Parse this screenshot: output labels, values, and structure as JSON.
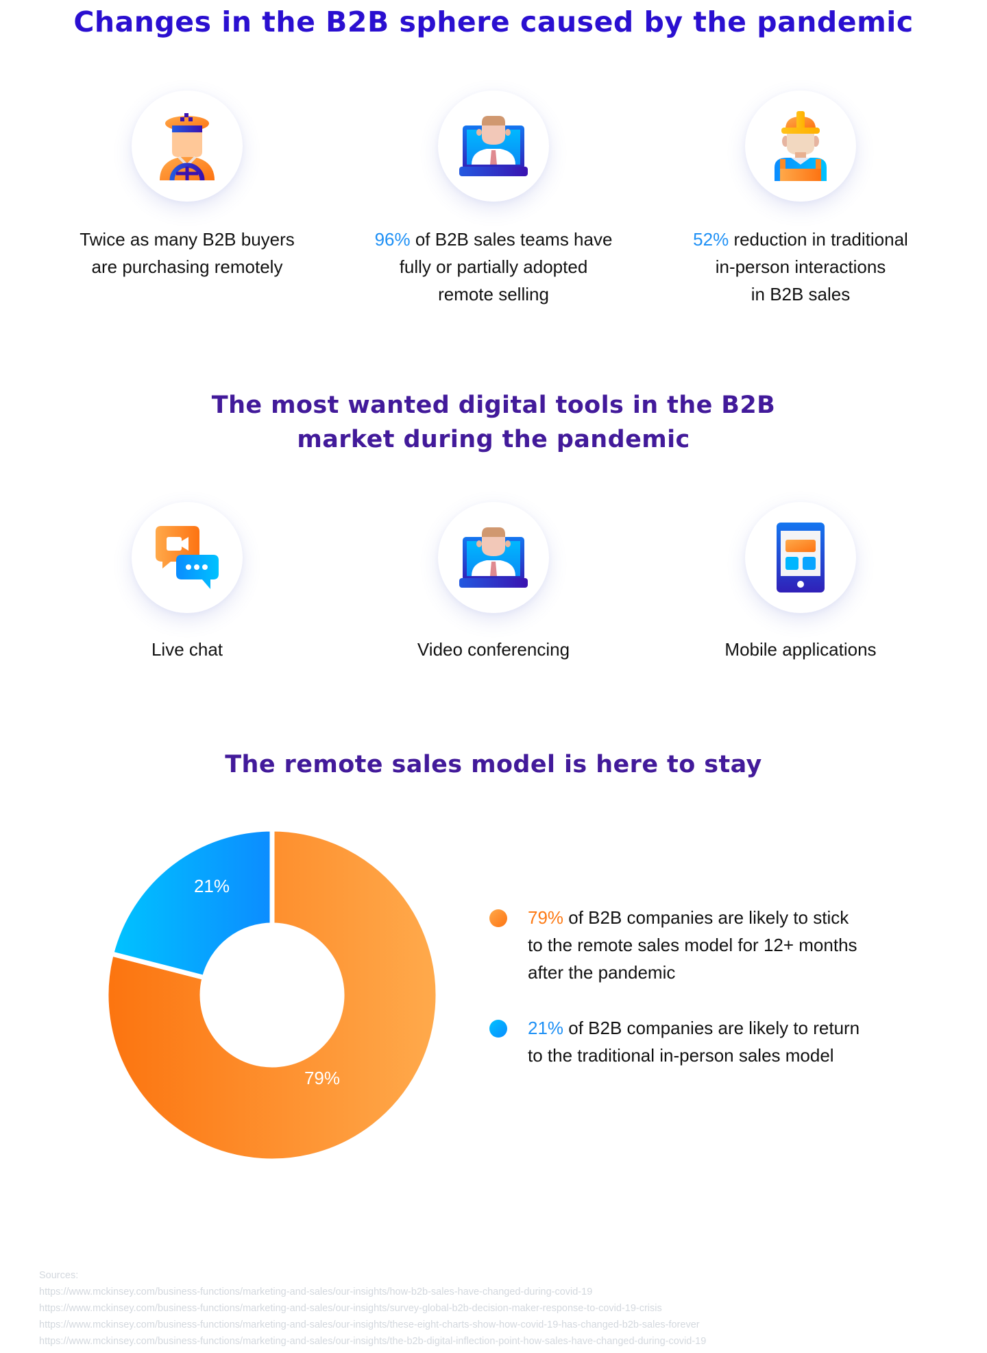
{
  "section1": {
    "title": "Changes in the B2B sphere caused by the pandemic",
    "stats": [
      {
        "icon": "taxi-driver-icon",
        "highlight": "",
        "lines": [
          "Twice as many B2B buyers",
          "are purchasing remotely"
        ]
      },
      {
        "icon": "laptop-person-icon",
        "highlight": "96%",
        "lines": [
          " of B2B sales teams have",
          "fully or partially adopted",
          "remote selling"
        ]
      },
      {
        "icon": "construction-worker-icon",
        "highlight": "52%",
        "lines": [
          " reduction in traditional",
          "in-person interactions",
          "in B2B sales"
        ]
      }
    ]
  },
  "section2": {
    "title_line1": "The most wanted digital tools in the B2B",
    "title_line2": "market during the pandemic",
    "tools": [
      {
        "icon": "live-chat-icon",
        "label": "Live chat"
      },
      {
        "icon": "video-conferencing-icon",
        "label": "Video conferencing"
      },
      {
        "icon": "mobile-app-icon",
        "label": "Mobile applications"
      }
    ]
  },
  "section3": {
    "title": "The remote sales model is here to stay",
    "legend": [
      {
        "highlight": "79%",
        "line1": " of B2B companies are likely to stick",
        "line2": "to the remote sales model for 12+ months",
        "line3": "after the pandemic"
      },
      {
        "highlight": "21%",
        "line1": " of B2B companies are likely to return",
        "line2": "to the traditional in-person sales model"
      }
    ]
  },
  "chart_data": {
    "type": "pie",
    "variant": "donut",
    "title": "The remote sales model is here to stay",
    "categories": [
      "Stick to the remote sales model for 12+ months",
      "Return to the traditional in-person sales model"
    ],
    "values": [
      79,
      21
    ],
    "labels": [
      "79%",
      "21%"
    ],
    "colors": [
      "#fd8a24",
      "#08a8ff"
    ],
    "legend_position": "right"
  },
  "colors": {
    "title": "#2a0fd0",
    "subtitle": "#421a9a",
    "highlight_blue": "#1e90f5",
    "highlight_orange": "#fd7a15",
    "sources_text": "#d3d8de"
  },
  "sources": {
    "heading": "Sources:",
    "links": [
      "https://www.mckinsey.com/business-functions/marketing-and-sales/our-insights/how-b2b-sales-have-changed-during-covid-19",
      "https://www.mckinsey.com/business-functions/marketing-and-sales/our-insights/survey-global-b2b-decision-maker-response-to-covid-19-crisis",
      "https://www.mckinsey.com/business-functions/marketing-and-sales/our-insights/these-eight-charts-show-how-covid-19-has-changed-b2b-sales-forever",
      "https://www.mckinsey.com/business-functions/marketing-and-sales/our-insights/the-b2b-digital-inflection-point-how-sales-have-changed-during-covid-19"
    ]
  }
}
